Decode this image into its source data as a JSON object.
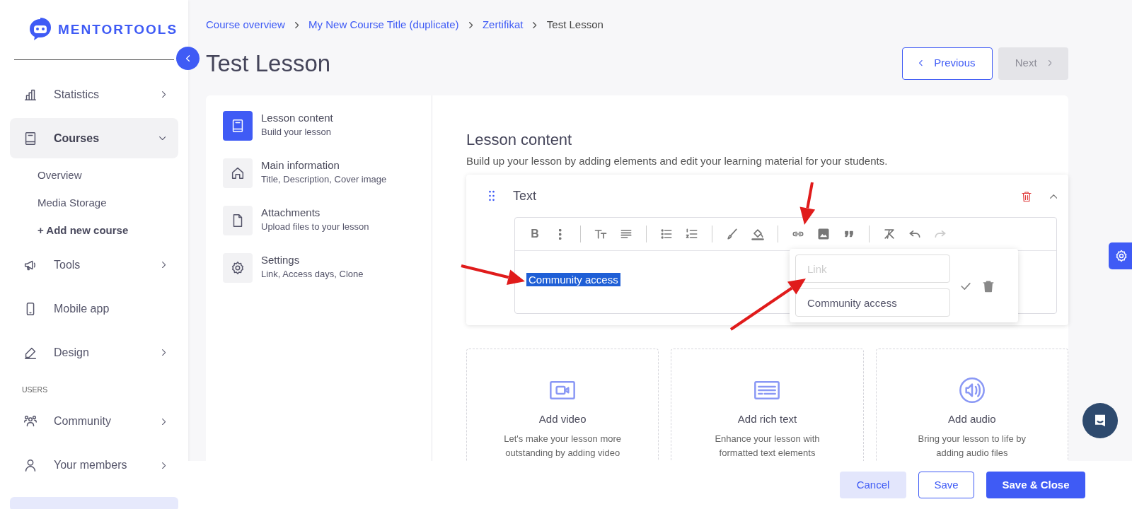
{
  "logo": {
    "text": "MENTORTOOLS"
  },
  "sidebar": {
    "groups": [
      {
        "items": [
          {
            "label": "Statistics",
            "kind": "expandable",
            "expanded": false,
            "selected": false
          },
          {
            "label": "Courses",
            "kind": "expandable",
            "expanded": true,
            "selected": true,
            "children": [
              {
                "label": "Overview",
                "kind": "link"
              },
              {
                "label": "Media Storage",
                "kind": "link"
              },
              {
                "label": "+ Add new course",
                "kind": "action"
              }
            ]
          },
          {
            "label": "Tools",
            "kind": "expandable",
            "expanded": false,
            "selected": false
          },
          {
            "label": "Mobile app",
            "kind": "link",
            "selected": false
          },
          {
            "label": "Design",
            "kind": "expandable",
            "expanded": false,
            "selected": false
          }
        ]
      },
      {
        "heading": "USERS",
        "items": [
          {
            "label": "Community",
            "kind": "expandable",
            "expanded": false,
            "selected": false
          },
          {
            "label": "Your members",
            "kind": "expandable",
            "expanded": false,
            "selected": false
          }
        ]
      }
    ]
  },
  "breadcrumbs": [
    {
      "label": "Course overview",
      "kind": "link"
    },
    {
      "label": "My New Course Title (duplicate)",
      "kind": "link"
    },
    {
      "label": "Zertifikat",
      "kind": "link"
    },
    {
      "label": "Test Lesson",
      "kind": "current"
    }
  ],
  "title": "Test Lesson",
  "pager": {
    "previous": {
      "label": "Previous",
      "disabled": false
    },
    "next": {
      "label": "Next",
      "disabled": true
    }
  },
  "lesson_nav": [
    {
      "title": "Lesson content",
      "subtitle": "Build your lesson",
      "selected": true
    },
    {
      "title": "Main information",
      "subtitle": "Title, Description, Cover image",
      "selected": false
    },
    {
      "title": "Attachments",
      "subtitle": "Upload files to your lesson",
      "selected": false
    },
    {
      "title": "Settings",
      "subtitle": "Link, Access days, Clone",
      "selected": false
    }
  ],
  "content": {
    "heading": "Lesson content",
    "description": "Build up your lesson by adding elements and edit your learning material for your students.",
    "block": {
      "title": "Text",
      "expanded": true,
      "toolbar": [
        [
          {
            "label": "B",
            "disabled": false
          },
          {
            "disabled": false
          }
        ],
        [
          {
            "disabled": false
          },
          {
            "disabled": false
          }
        ],
        [
          {
            "disabled": false
          },
          {
            "disabled": false
          }
        ],
        [
          {
            "disabled": false
          },
          {
            "disabled": false
          }
        ],
        [
          {
            "disabled": false
          },
          {
            "disabled": false
          },
          {
            "disabled": false
          }
        ],
        [
          {
            "disabled": false
          },
          {
            "disabled": false
          },
          {
            "disabled": true
          }
        ]
      ],
      "editor_text": "Community access",
      "editor_text_selected": true,
      "link_popover": {
        "placeholder": "Link",
        "text": "Community access"
      }
    },
    "add_cards": [
      {
        "title": "Add video",
        "description": [
          "Let's make your lesson more",
          "outstanding by adding video"
        ]
      },
      {
        "title": "Add rich text",
        "description": [
          "Enhance your lesson with",
          "formatted text elements"
        ]
      },
      {
        "title": "Add audio",
        "description": [
          "Bring your lesson to life by",
          "adding audio files"
        ]
      }
    ]
  },
  "footer": {
    "buttons": [
      {
        "label": "Cancel",
        "kind": "soft"
      },
      {
        "label": "Save",
        "kind": "outline"
      },
      {
        "label": "Save & Close",
        "kind": "primary"
      }
    ]
  }
}
